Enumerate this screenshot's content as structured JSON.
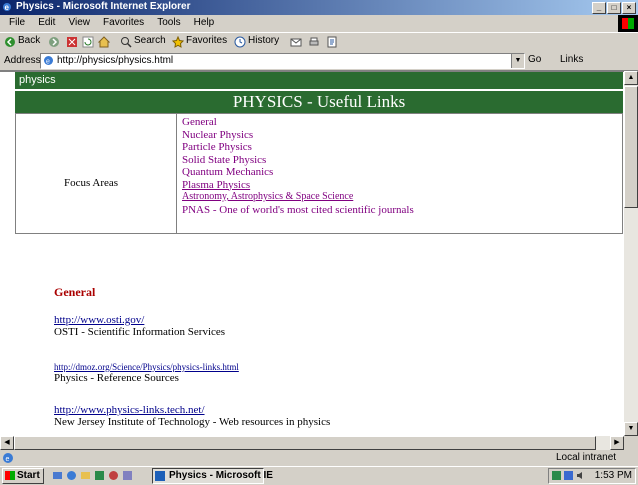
{
  "window": {
    "title": "Physics - Microsoft Internet Explorer",
    "controls": [
      "_",
      "□",
      "×"
    ]
  },
  "menu": [
    "File",
    "Edit",
    "View",
    "Favorites",
    "Tools",
    "Help"
  ],
  "toolbar": {
    "back": "Back",
    "search": "Search",
    "favorites": "Favorites",
    "history": "History"
  },
  "address": {
    "label": "Address",
    "url": "http://physics/physics.html",
    "go": "Go",
    "links": "Links"
  },
  "page": {
    "section_bar": "physics",
    "banner": "PHYSICS - Useful Links",
    "focus_label": "Focus Areas",
    "focus_links": [
      "General",
      "Nuclear Physics",
      "Particle Physics",
      "Solid State Physics",
      "Quantum Mechanics",
      "Plasma Physics",
      "Astronomy, Astrophysics & Space Science",
      "PNAS - One of world's most cited scientific journals"
    ],
    "general_heading": "General",
    "entries": [
      {
        "link": "http://www.osti.gov/",
        "desc": "OSTI - Scientific Information Services"
      },
      {
        "link": "http://dmoz.org/Science/Physics/physics-links.html",
        "desc": "Physics - Reference Sources"
      },
      {
        "link": "http://www.physics-links.tech.net/",
        "desc": "New Jersey Institute of Technology - Web resources in physics"
      }
    ]
  },
  "status": {
    "zone": "Local intranet"
  },
  "taskbar": {
    "start": "Start",
    "task_item": "Physics - Microsoft IE",
    "clock": "1:53 PM"
  }
}
